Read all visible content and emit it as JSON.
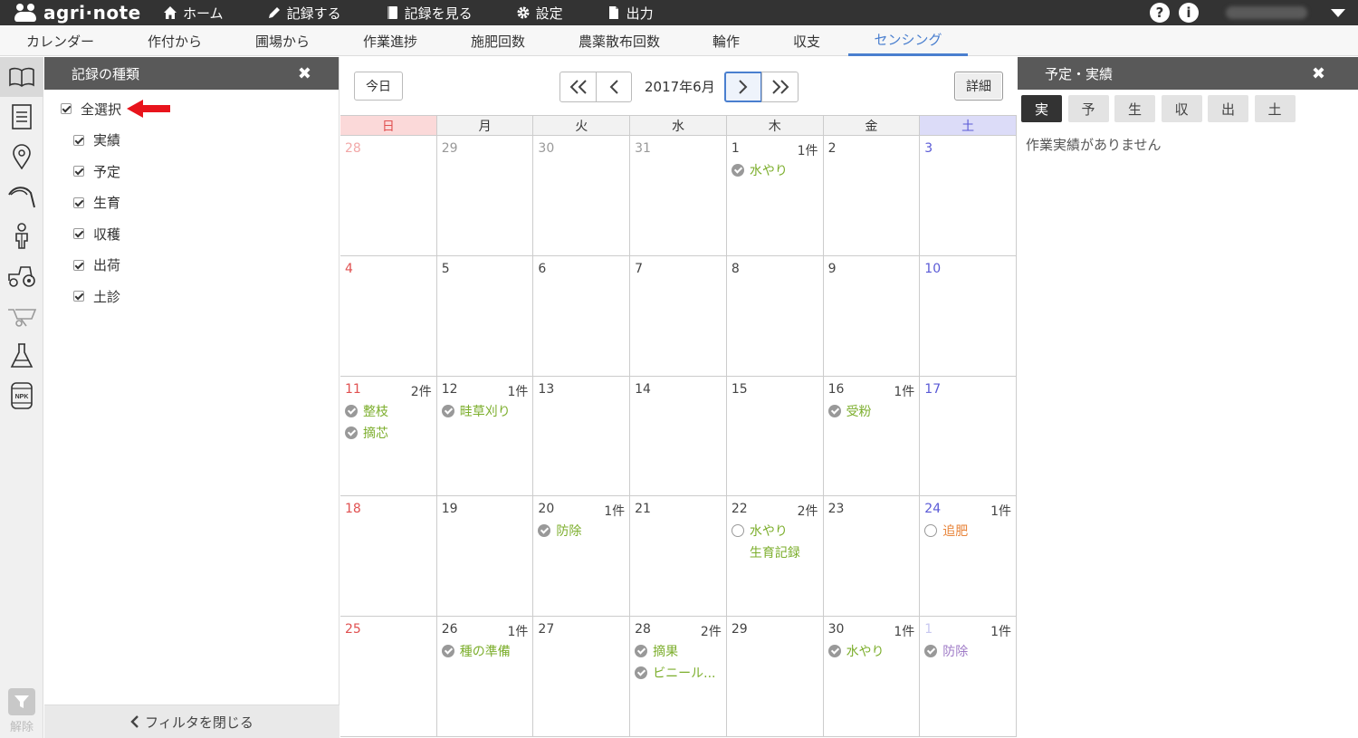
{
  "app": {
    "name": "agri·note"
  },
  "nav": [
    {
      "label": "ホーム",
      "icon": "home-icon"
    },
    {
      "label": "記録する",
      "icon": "pencil-icon"
    },
    {
      "label": "記録を見る",
      "icon": "book-icon"
    },
    {
      "label": "設定",
      "icon": "gear-icon"
    },
    {
      "label": "出力",
      "icon": "file-icon"
    }
  ],
  "topbar_right": {
    "help": "?",
    "info": "i"
  },
  "tabs": [
    "カレンダー",
    "作付から",
    "圃場から",
    "作業進捗",
    "施肥回数",
    "農薬散布回数",
    "輪作",
    "収支",
    "センシング"
  ],
  "active_tab": "センシング",
  "filter": {
    "title": "記録の種類",
    "close": "✖",
    "select_all": "全選択",
    "items": [
      "実績",
      "予定",
      "生育",
      "収穫",
      "出荷",
      "土診"
    ],
    "footer": "フィルタを閉じる"
  },
  "rail": {
    "release_label": "解除"
  },
  "calendar": {
    "today_label": "今日",
    "month_label": "2017年6月",
    "detail_label": "詳細",
    "weekdays": [
      "日",
      "月",
      "火",
      "水",
      "木",
      "金",
      "土"
    ],
    "weeks": [
      [
        {
          "d": "28",
          "style": "fadedred"
        },
        {
          "d": "29",
          "style": "gray"
        },
        {
          "d": "30",
          "style": "gray"
        },
        {
          "d": "31",
          "style": "gray"
        },
        {
          "d": "1",
          "count": "1件",
          "events": [
            {
              "t": "水やり",
              "mark": "done",
              "color": "green"
            }
          ]
        },
        {
          "d": "2"
        },
        {
          "d": "3",
          "style": "blue"
        }
      ],
      [
        {
          "d": "4",
          "style": "red"
        },
        {
          "d": "5"
        },
        {
          "d": "6"
        },
        {
          "d": "7"
        },
        {
          "d": "8"
        },
        {
          "d": "9"
        },
        {
          "d": "10",
          "style": "blue"
        }
      ],
      [
        {
          "d": "11",
          "style": "red",
          "count": "2件",
          "events": [
            {
              "t": "整枝",
              "mark": "done",
              "color": "green"
            },
            {
              "t": "摘芯",
              "mark": "done",
              "color": "green"
            }
          ]
        },
        {
          "d": "12",
          "count": "1件",
          "events": [
            {
              "t": "畦草刈り",
              "mark": "done",
              "color": "green"
            }
          ]
        },
        {
          "d": "13"
        },
        {
          "d": "14"
        },
        {
          "d": "15"
        },
        {
          "d": "16",
          "count": "1件",
          "events": [
            {
              "t": "受粉",
              "mark": "done",
              "color": "green"
            }
          ]
        },
        {
          "d": "17",
          "style": "blue"
        }
      ],
      [
        {
          "d": "18",
          "style": "red"
        },
        {
          "d": "19"
        },
        {
          "d": "20",
          "count": "1件",
          "events": [
            {
              "t": "防除",
              "mark": "done",
              "color": "green"
            }
          ]
        },
        {
          "d": "21"
        },
        {
          "d": "22",
          "count": "2件",
          "events": [
            {
              "t": "水やり",
              "mark": "plan",
              "color": "green"
            },
            {
              "t": "生育記録",
              "mark": "none",
              "color": "green"
            }
          ]
        },
        {
          "d": "23"
        },
        {
          "d": "24",
          "style": "blue",
          "count": "1件",
          "events": [
            {
              "t": "追肥",
              "mark": "plan",
              "color": "orange"
            }
          ]
        }
      ],
      [
        {
          "d": "25",
          "style": "red"
        },
        {
          "d": "26",
          "count": "1件",
          "events": [
            {
              "t": "種の準備",
              "mark": "done",
              "color": "green"
            }
          ]
        },
        {
          "d": "27"
        },
        {
          "d": "28",
          "count": "2件",
          "events": [
            {
              "t": "摘果",
              "mark": "done",
              "color": "green"
            },
            {
              "t": "ビニール...",
              "mark": "done",
              "color": "green"
            }
          ]
        },
        {
          "d": "29"
        },
        {
          "d": "30",
          "count": "1件",
          "events": [
            {
              "t": "水やり",
              "mark": "done",
              "color": "green"
            }
          ]
        },
        {
          "d": "1",
          "style": "fadedblue",
          "count": "1件",
          "events": [
            {
              "t": "防除",
              "mark": "done",
              "color": "purple"
            }
          ]
        }
      ]
    ]
  },
  "right_panel": {
    "title": "予定・実績",
    "close": "✖",
    "tabs": [
      "実",
      "予",
      "生",
      "収",
      "出",
      "土"
    ],
    "active_tab": "実",
    "empty_message": "作業実績がありません"
  }
}
